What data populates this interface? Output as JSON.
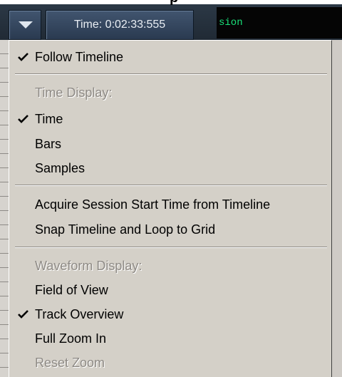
{
  "background": {
    "top_text": "p",
    "right_panel_text": "sion"
  },
  "toolbar": {
    "dropdown_icon": "triangle-down-icon",
    "time_label": "Time: 0:02:33:555"
  },
  "menu": {
    "follow_timeline": "Follow Timeline",
    "time_display_header": "Time Display:",
    "time": "Time",
    "bars": "Bars",
    "samples": "Samples",
    "acquire_start": "Acquire Session Start Time from Timeline",
    "snap_timeline": "Snap Timeline and Loop to Grid",
    "waveform_display_header": "Waveform Display:",
    "field_of_view": "Field of View",
    "track_overview": "Track Overview",
    "full_zoom_in": "Full Zoom In",
    "reset_zoom": "Reset Zoom"
  },
  "checked": [
    "follow_timeline",
    "time",
    "track_overview"
  ],
  "colors": {
    "menu_bg": "#d4d0c8",
    "disabled_text": "#8e8a85",
    "panel_green": "#19e27a"
  }
}
